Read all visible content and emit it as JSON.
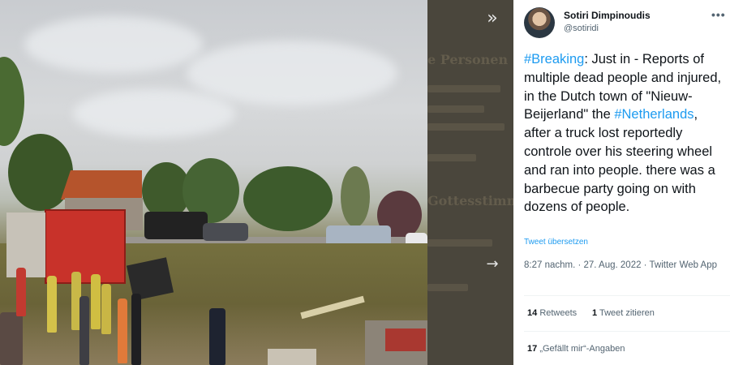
{
  "viewer": {
    "next_glyph": "»",
    "arrow_glyph": "→",
    "background_text": {
      "heading_a": "e Personen",
      "heading_b": "Gottesstimme"
    }
  },
  "tweet": {
    "author_name": "Sotiri Dimpinoudis",
    "author_handle": "@sotiridi",
    "more_glyph": "•••",
    "segments": [
      {
        "text": "#Breaking",
        "hashtag": true
      },
      {
        "text": ": Just in - Reports of multiple dead people and injured, in the Dutch town of \"Nieuw-Beijerland\" the ",
        "hashtag": false
      },
      {
        "text": "#Netherlands",
        "hashtag": true
      },
      {
        "text": ", after a truck lost reportedly controle over his steering wheel and ran into people. there was a barbecue party going on with dozens of people.",
        "hashtag": false
      }
    ],
    "translate_label": "Tweet übersetzen",
    "timestamp": "8:27 nachm. · 27. Aug. 2022 · Twitter Web App",
    "stats": {
      "retweets_count": "14",
      "retweets_label": "Retweets",
      "quotes_count": "1",
      "quotes_label": "Tweet zitieren",
      "likes_count": "17",
      "likes_label": "„Gefällt mir“-Angaben"
    }
  },
  "colors": {
    "hashtag": "#1d9bf0",
    "secondary_text": "#536471",
    "dark_strip": "#4a463c"
  }
}
